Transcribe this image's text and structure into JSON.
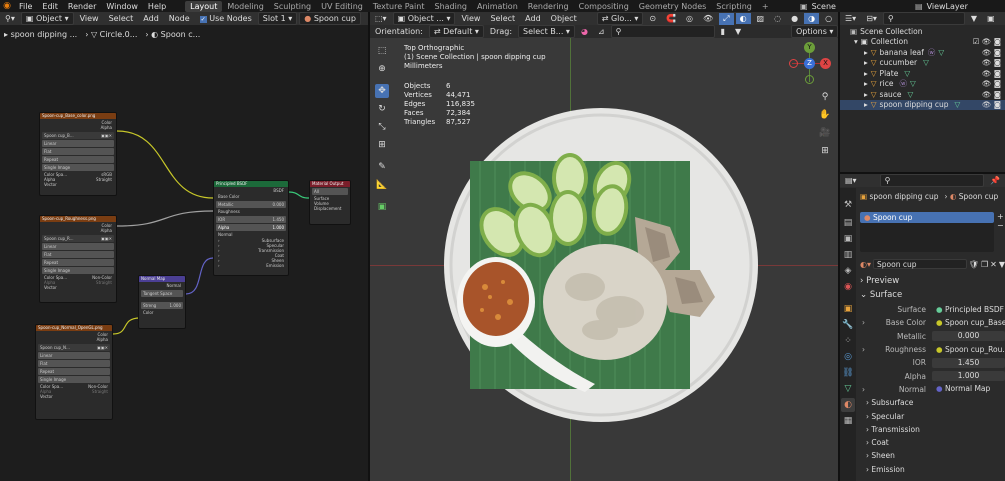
{
  "top_menu": [
    "File",
    "Edit",
    "Render",
    "Window",
    "Help"
  ],
  "workspaces": [
    "Layout",
    "Modeling",
    "Sculpting",
    "UV Editing",
    "Texture Paint",
    "Shading",
    "Animation",
    "Rendering",
    "Compositing",
    "Geometry Nodes",
    "Scripting"
  ],
  "scene_name": "Scene",
  "view_layer": "ViewLayer",
  "node_editor": {
    "header": {
      "mode": "Object",
      "menus": [
        "View",
        "Select",
        "Add",
        "Node"
      ],
      "use_nodes": "Use Nodes",
      "slot": "Slot 1",
      "material": "Spoon cup"
    },
    "breadcrumb": [
      "spoon dipping ...",
      "Circle.0...",
      "Spoon c..."
    ],
    "nodes": {
      "base_tex": {
        "title": "Spoon-cup_Base_color.png",
        "outs": [
          "Color",
          "Alpha"
        ],
        "image": "Spoon cup_B...",
        "opts": [
          "Linear",
          "Flat",
          "Repeat",
          "Single Image"
        ],
        "cs_label": "Color Spa...",
        "cs_val": "sRGB",
        "alpha_label": "Alpha",
        "alpha_val": "Straight",
        "vector": "Vector"
      },
      "rough_tex": {
        "title": "Spoon-cup_Roughness.png",
        "outs": [
          "Color",
          "Alpha"
        ],
        "image": "Spoon cup_R...",
        "opts": [
          "Linear",
          "Flat",
          "Repeat",
          "Single Image"
        ],
        "cs_label": "Color Spa...",
        "cs_val": "Non-Color",
        "alpha_label": "Alpha",
        "alpha_val": "Straight",
        "vector": "Vector"
      },
      "normal_tex": {
        "title": "Spoon-cup_Normal_OpenGL.png",
        "outs": [
          "Color",
          "Alpha"
        ],
        "image": "Spoon cup_N...",
        "opts": [
          "Linear",
          "Flat",
          "Repeat",
          "Single Image"
        ],
        "cs_label": "Color Spa...",
        "cs_val": "Non-Color",
        "alpha_label": "Alpha",
        "alpha_val": "Straight",
        "vector": "Vector"
      },
      "normal_map": {
        "title": "Normal Map",
        "out": "Normal",
        "space": "Tangent Space",
        "str_label": "Streng",
        "str_val": "1.000",
        "color": "Color"
      },
      "bsdf": {
        "title": "Principled BSDF",
        "out": "BSDF",
        "base_color": "Base Color",
        "metallic": "Metallic",
        "metallic_val": "0.000",
        "roughness": "Roughness",
        "ior": "IOR",
        "ior_val": "1.450",
        "alpha": "Alpha",
        "alpha_val": "1.000",
        "normal": "Normal",
        "subs": [
          "Subsurface",
          "Specular",
          "Transmission",
          "Coat",
          "Sheen",
          "Emission"
        ]
      },
      "output": {
        "title": "Material Output",
        "target": "All",
        "ins": [
          "Surface",
          "Volume",
          "Displacement"
        ]
      }
    }
  },
  "viewport": {
    "header": {
      "mode": "Object ...",
      "menus": [
        "View",
        "Select",
        "Add",
        "Object"
      ],
      "transform": "Glo..."
    },
    "header2": {
      "orientation_label": "Orientation:",
      "orientation": "Default",
      "drag_label": "Drag:",
      "drag": "Select B...",
      "options": "Options"
    },
    "overlay": {
      "view": "Top Orthographic",
      "collection": "(1) Scene Collection | spoon dipping cup",
      "units": "Millimeters"
    },
    "stats": [
      {
        "k": "Objects",
        "v": "6"
      },
      {
        "k": "Vertices",
        "v": "44,471"
      },
      {
        "k": "Edges",
        "v": "116,835"
      },
      {
        "k": "Faces",
        "v": "72,384"
      },
      {
        "k": "Triangles",
        "v": "87,527"
      }
    ],
    "gizmo": {
      "x": "X",
      "y": "Y",
      "z": "Z"
    }
  },
  "outliner": {
    "root": "Scene Collection",
    "collection": "Collection",
    "items": [
      "banana leaf",
      "cucumber",
      "Plate",
      "rice",
      "sauce",
      "spoon dipping cup"
    ]
  },
  "properties": {
    "object_path": [
      "spoon dipping cup",
      "Spoon cup"
    ],
    "material_slot": "Spoon cup",
    "material_name": "Spoon cup",
    "sections": {
      "preview": "Preview",
      "surface": "Surface"
    },
    "rows": [
      {
        "label": "Surface",
        "value": "Principled BSDF"
      },
      {
        "label": "Base Color",
        "value": "Spoon cup_Base..."
      },
      {
        "label": "Metallic",
        "value": "0.000"
      },
      {
        "label": "Roughness",
        "value": "Spoon cup_Rou..."
      },
      {
        "label": "IOR",
        "value": "1.450"
      },
      {
        "label": "Alpha",
        "value": "1.000"
      },
      {
        "label": "Normal",
        "value": "Normal Map"
      }
    ],
    "collapsed": [
      "Subsurface",
      "Specular",
      "Transmission",
      "Coat",
      "Sheen",
      "Emission"
    ]
  },
  "colors": {
    "accent": "#4772b3",
    "yellow_link": "#c7c729",
    "grey_link": "#a1a1a1",
    "purple_link": "#6363c7",
    "tex_header": "#7a3d12",
    "bsdf_header": "#1c6a3a",
    "normal_header": "#4b3f94",
    "output_header": "#7a1e2a"
  }
}
